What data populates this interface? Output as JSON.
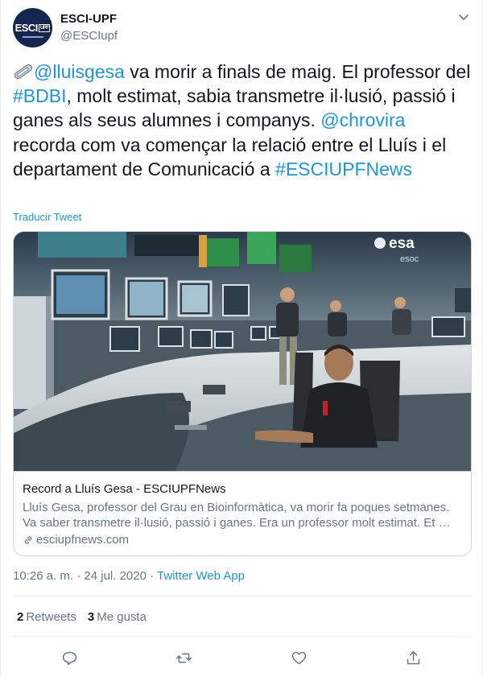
{
  "author": {
    "name": "ESCI-UPF",
    "handle": "@ESCIupf",
    "avatar_text": "ESCI",
    "avatar_box": "UPF"
  },
  "tweet": {
    "segments": [
      {
        "kind": "link",
        "text": "@lluisgesa"
      },
      {
        "kind": "text",
        "text": " va morir a finals de maig. El professor del "
      },
      {
        "kind": "link",
        "text": "#BDBI"
      },
      {
        "kind": "text",
        "text": ", molt estimat, sabia transmetre il·lusió, passió i ganes als seus alumnes i companys. "
      },
      {
        "kind": "link",
        "text": "@chrovira"
      },
      {
        "kind": "text",
        "text": " recorda com va començar la relació entre el Lluís i el departament de Comunicació a "
      },
      {
        "kind": "link",
        "text": "#ESCIUPFNews"
      }
    ],
    "translate_label": "Traducir Tweet"
  },
  "card": {
    "title": "Record a Lluís Gesa - ESCIUPFNews",
    "description": "Lluís Gesa, professor del Grau en Bioinformàtica, va morir fa poques setmanes. Va saber transmetre il·lusió, passió i ganes. Era un professor molt estimat. Et …",
    "domain": "esciupfnews.com",
    "image_logo_text": "esa",
    "image_logo_sub": "esoc"
  },
  "meta": {
    "time": "10:26 a. m.",
    "separator": "·",
    "date": "24 jul. 2020",
    "app": "Twitter Web App"
  },
  "stats": {
    "retweets_count": "2",
    "retweets_label": "Retweets",
    "likes_count": "3",
    "likes_label": "Me gusta"
  },
  "icons": {
    "reply": "reply-icon",
    "retweet": "retweet-icon",
    "like": "heart-icon",
    "share": "share-icon",
    "caret": "chevron-down-icon",
    "emoji": "paperclip-emoji-icon",
    "link": "link-icon"
  },
  "colors": {
    "link": "#1b95e0",
    "secondary": "#657786",
    "border": "#e6ecf0",
    "avatar_bg": "#16254f"
  }
}
